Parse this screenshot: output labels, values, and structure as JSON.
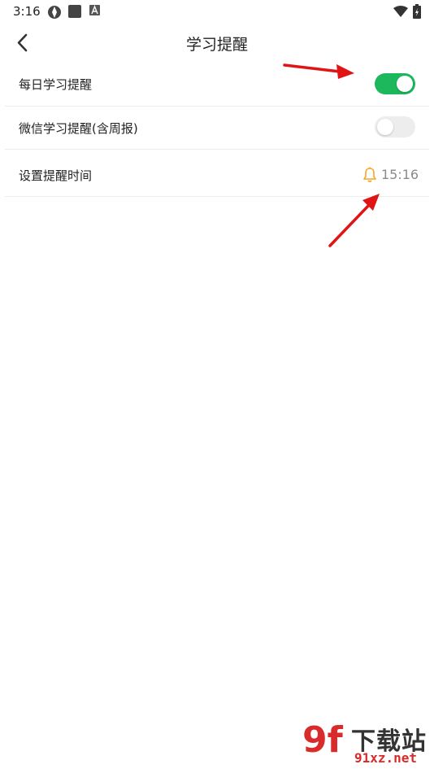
{
  "status_bar": {
    "time": "3:16",
    "icons": [
      "app-notification-icon",
      "square-app-icon",
      "a-app-icon",
      "wifi-icon",
      "battery-charging-icon"
    ]
  },
  "header": {
    "back_icon": "chevron-left-icon",
    "title": "学习提醒"
  },
  "settings": {
    "daily_reminder": {
      "label": "每日学习提醒",
      "enabled": true
    },
    "wechat_reminder": {
      "label": "微信学习提醒(含周报)",
      "enabled": false
    },
    "reminder_time": {
      "label": "设置提醒时间",
      "icon": "bell-icon",
      "value": "15:16"
    }
  },
  "colors": {
    "toggle_on": "#1db75c",
    "toggle_off": "#ededed",
    "bell": "#f5a623",
    "annotation_arrow": "#e01414",
    "watermark": "#d92b2b"
  },
  "watermark": {
    "logo_glyph": "9f",
    "brand": "下载站",
    "url": "91xz.net"
  }
}
